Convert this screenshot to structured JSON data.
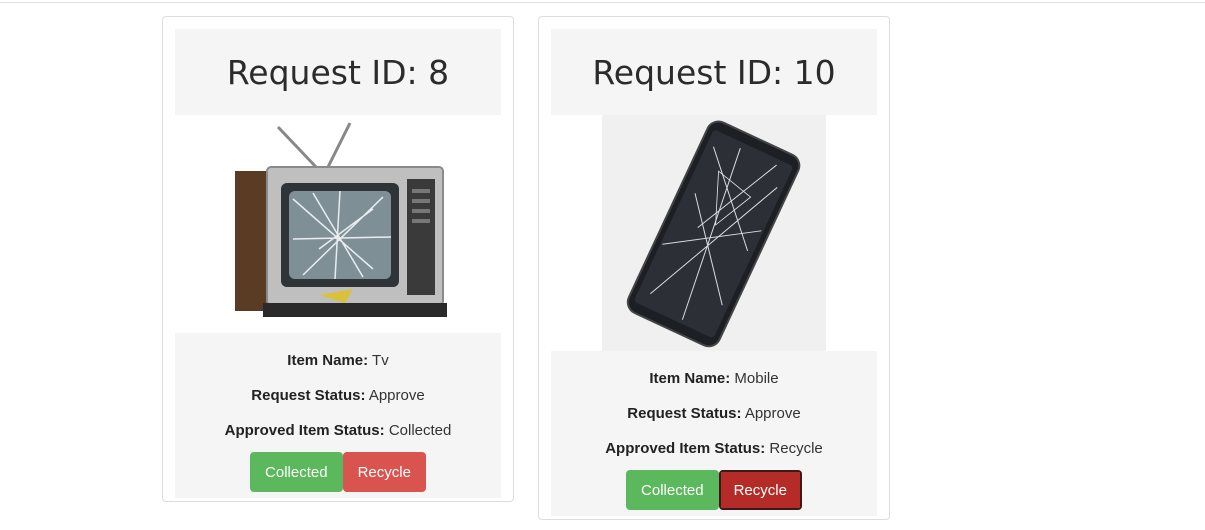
{
  "cards": [
    {
      "title": "Request ID: 8",
      "image_icon": "tv-icon",
      "item_name_label": "Item Name:",
      "item_name": "Tv",
      "request_status_label": "Request Status:",
      "request_status": "Approve",
      "approved_status_label": "Approved Item Status:",
      "approved_status": "Collected",
      "collected_button": "Collected",
      "recycle_button": "Recycle"
    },
    {
      "title": "Request ID: 10",
      "image_icon": "mobile-icon",
      "item_name_label": "Item Name:",
      "item_name": "Mobile",
      "request_status_label": "Request Status:",
      "request_status": "Approve",
      "approved_status_label": "Approved Item Status:",
      "approved_status": "Recycle",
      "collected_button": "Collected",
      "recycle_button": "Recycle"
    }
  ],
  "colors": {
    "collected": "#5cb85c",
    "recycle": "#d9534f",
    "recycle_active": "#b52b27",
    "panel_bg": "#f5f5f5"
  }
}
